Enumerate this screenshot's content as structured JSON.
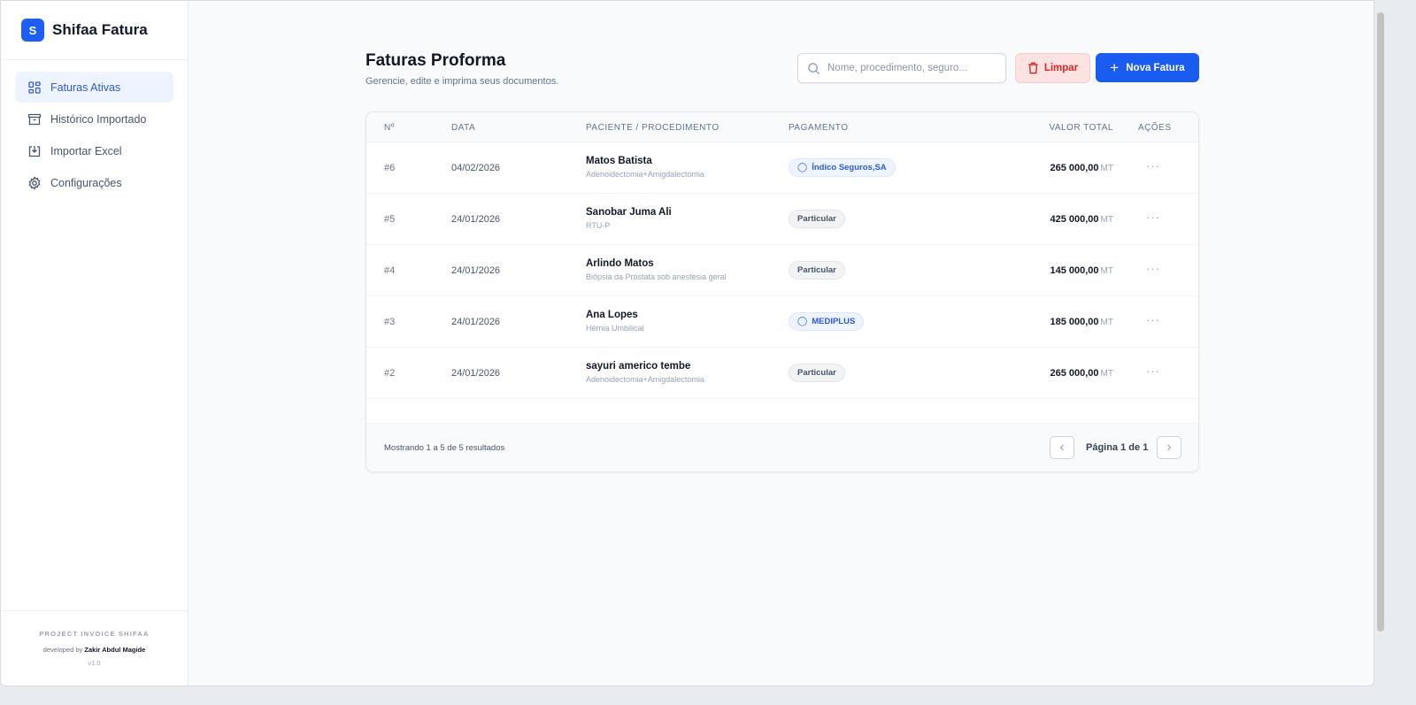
{
  "brand": {
    "logo_letter": "S",
    "name": "Shifaa Fatura"
  },
  "sidebar": {
    "items": [
      {
        "label": "Faturas Ativas",
        "icon": "grid-icon",
        "active": true
      },
      {
        "label": "Histórico Importado",
        "icon": "archive-icon"
      },
      {
        "label": "Importar Excel",
        "icon": "import-icon"
      },
      {
        "label": "Configurações",
        "icon": "gear-icon"
      }
    ],
    "footer": {
      "project": "PROJECT INVOICE SHIFAA",
      "developed_by": "developed by",
      "author": "Zakir Abdul Magide",
      "version": "v1.0"
    }
  },
  "header": {
    "title": "Faturas Proforma",
    "subtitle": "Gerencie, edite e imprima seus documentos."
  },
  "toolbar": {
    "search_placeholder": "Nome, procedimento, seguro...",
    "clear_label": "Limpar",
    "new_label": "Nova Fatura"
  },
  "table": {
    "columns": [
      "Nº",
      "DATA",
      "PACIENTE / PROCEDIMENTO",
      "PAGAMENTO",
      "VALOR TOTAL",
      "AÇÕES"
    ],
    "rows": [
      {
        "no": "#6",
        "date": "04/02/2026",
        "patient": "Matos Batista",
        "procedure": "Adenoidectomia+Amigdalectomia",
        "payment": "Índico Seguros,SA",
        "insured": true,
        "value": "265 000,00",
        "currency": "MT"
      },
      {
        "no": "#5",
        "date": "24/01/2026",
        "patient": "Sanobar Juma Ali",
        "procedure": "RTU-P",
        "payment": "Particular",
        "insured": false,
        "value": "425 000,00",
        "currency": "MT"
      },
      {
        "no": "#4",
        "date": "24/01/2026",
        "patient": "Arlindo Matos",
        "procedure": "Biópsia da Próstata sob anestesia geral",
        "payment": "Particular",
        "insured": false,
        "value": "145 000,00",
        "currency": "MT"
      },
      {
        "no": "#3",
        "date": "24/01/2026",
        "patient": "Ana Lopes",
        "procedure": "Hérnia Umbilical",
        "payment": "MEDIPLUS",
        "insured": true,
        "value": "185 000,00",
        "currency": "MT"
      },
      {
        "no": "#2",
        "date": "24/01/2026",
        "patient": "sayuri americo tembe",
        "procedure": "Adenoidectomia+Amigdalectomia",
        "payment": "Particular",
        "insured": false,
        "value": "265 000,00",
        "currency": "MT"
      }
    ],
    "actions_glyph": "···"
  },
  "pagination": {
    "showing": "Mostrando 1 a 5 de 5 resultados",
    "page_label": "Página 1 de 1"
  }
}
